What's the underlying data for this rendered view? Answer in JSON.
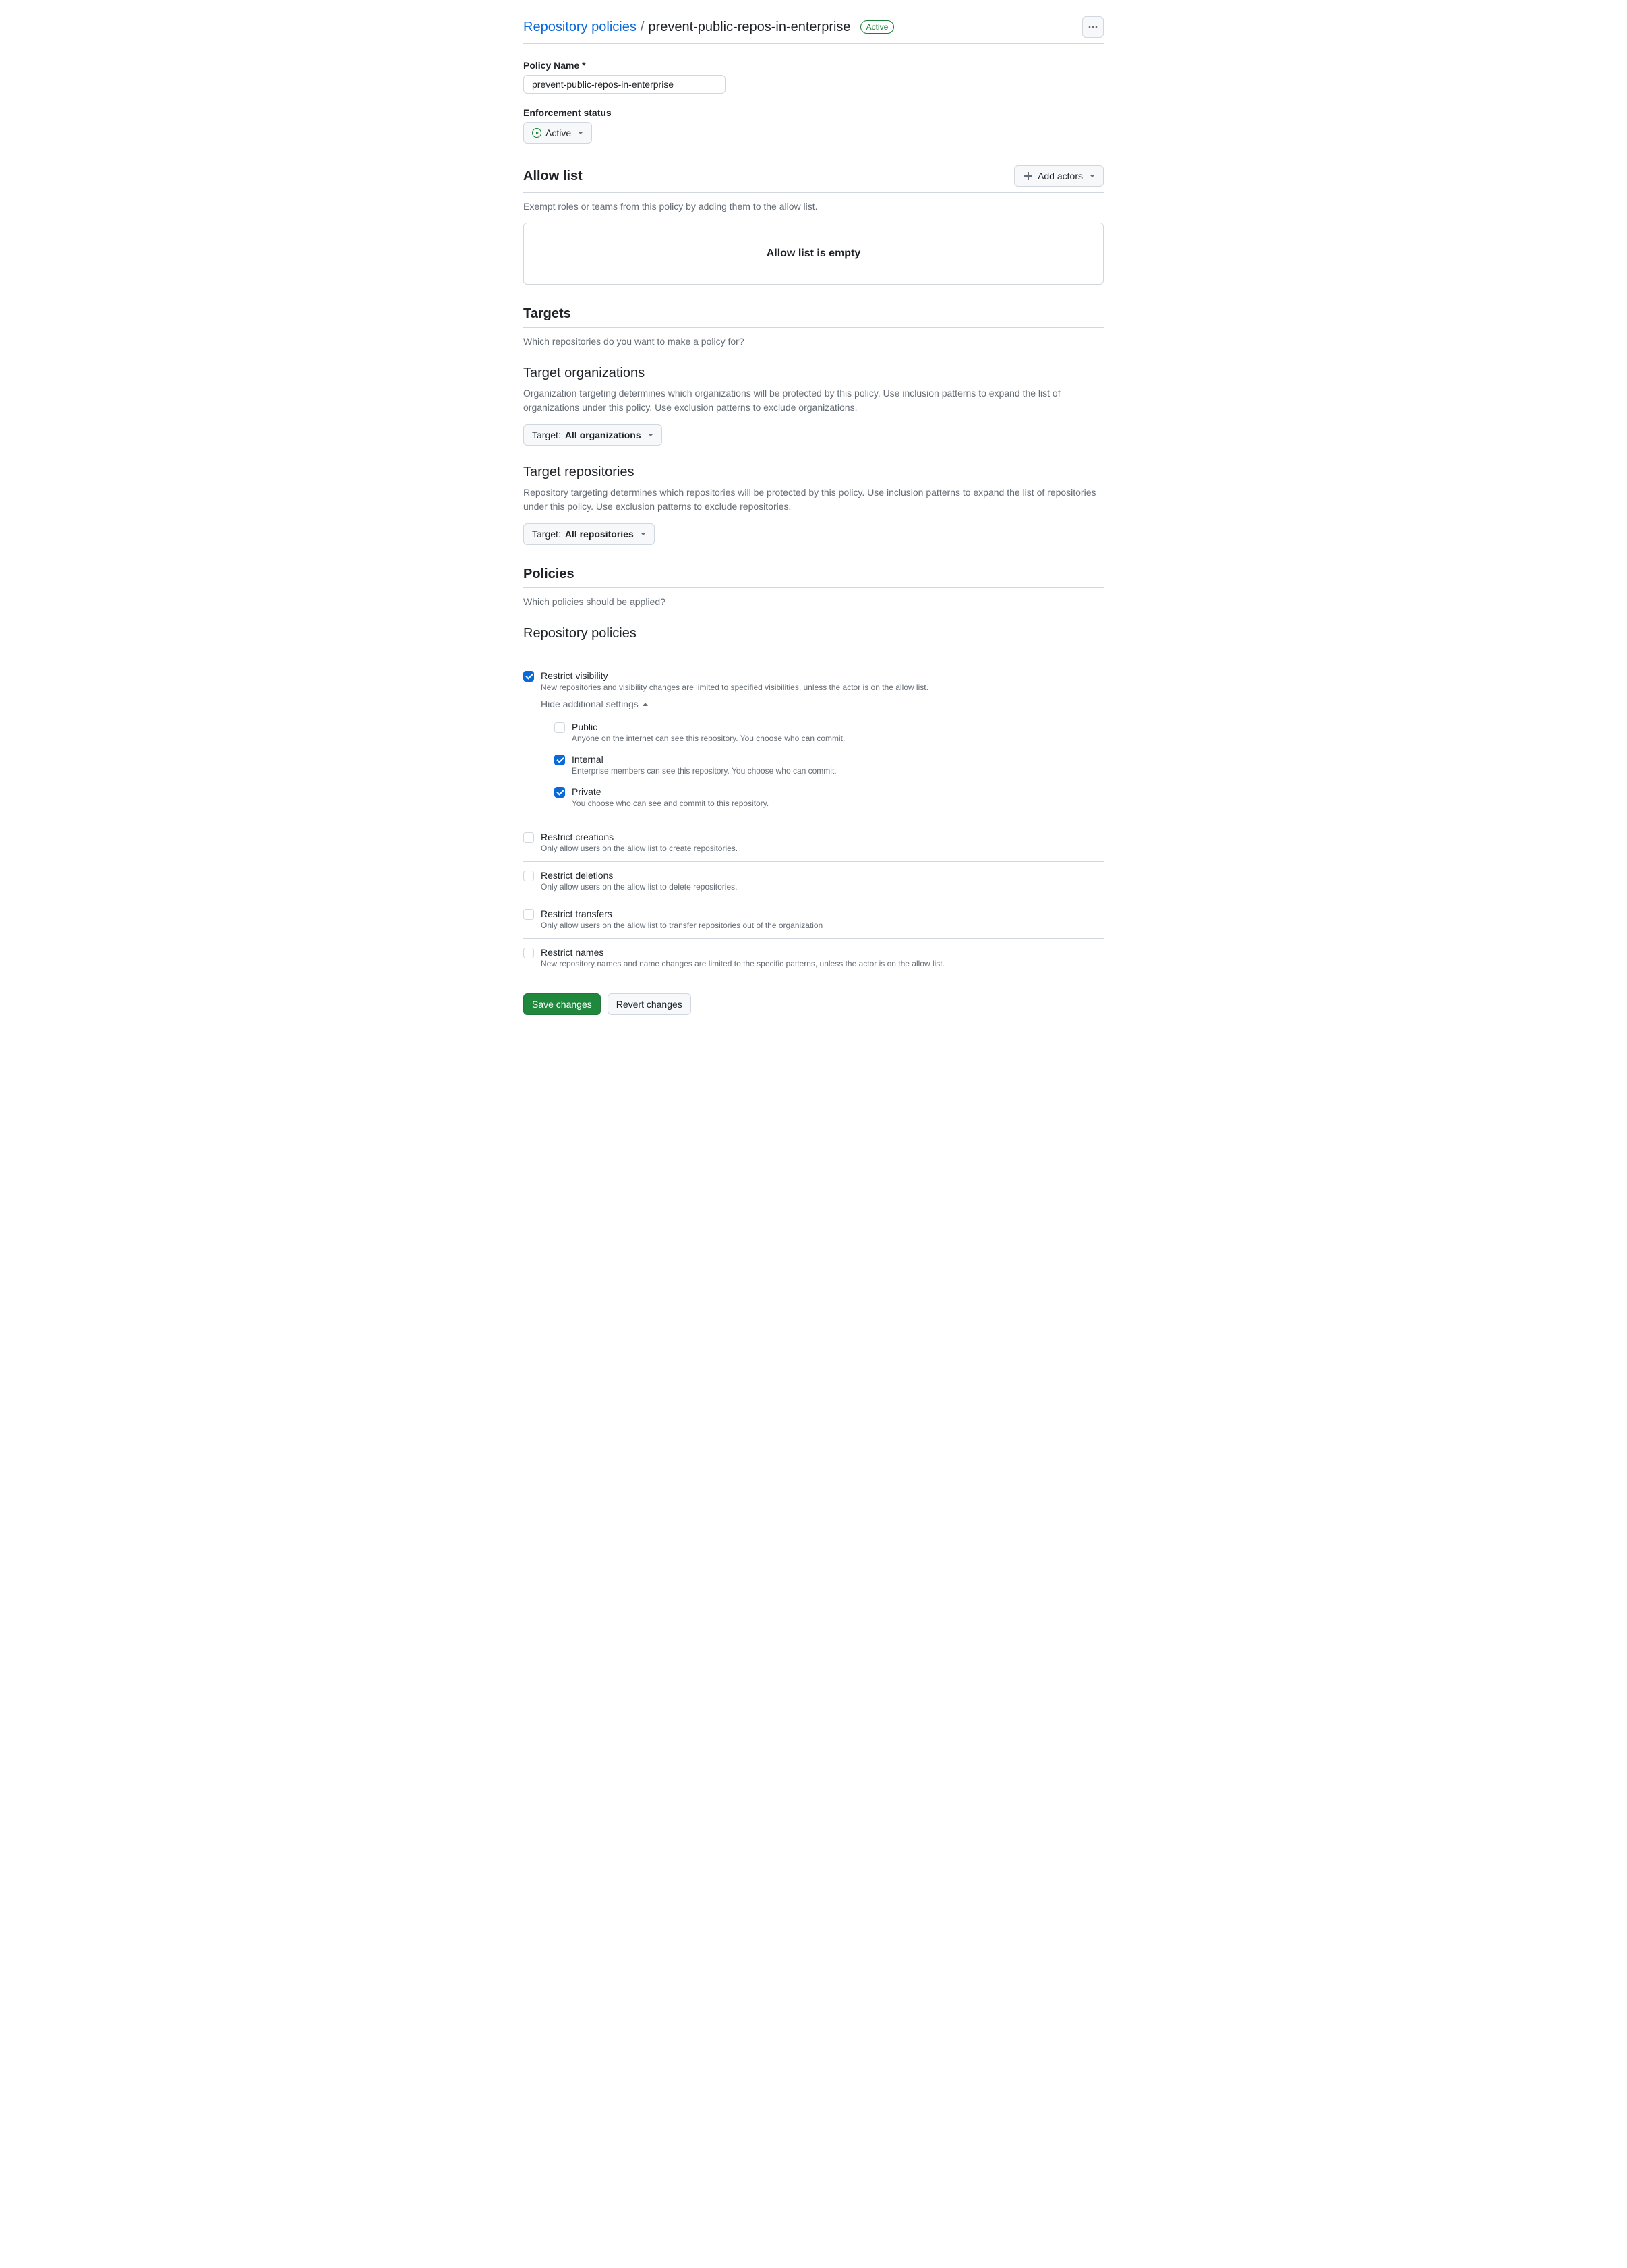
{
  "breadcrumb": {
    "parent": "Repository policies",
    "current": "prevent-public-repos-in-enterprise"
  },
  "status_badge": "Active",
  "policy_name": {
    "label": "Policy Name *",
    "value": "prevent-public-repos-in-enterprise"
  },
  "enforcement": {
    "label": "Enforcement status",
    "value": "Active"
  },
  "allow_list": {
    "title": "Allow list",
    "add_button": "Add actors",
    "description": "Exempt roles or teams from this policy by adding them to the allow list.",
    "empty_msg": "Allow list is empty"
  },
  "targets": {
    "title": "Targets",
    "description": "Which repositories do you want to make a policy for?",
    "orgs": {
      "title": "Target organizations",
      "description": "Organization targeting determines which organizations will be protected by this policy. Use inclusion patterns to expand the list of organizations under this policy. Use exclusion patterns to exclude organizations.",
      "button_prefix": "Target: ",
      "button_value": "All organizations"
    },
    "repos": {
      "title": "Target repositories",
      "description": "Repository targeting determines which repositories will be protected by this policy. Use inclusion patterns to expand the list of repositories under this policy. Use exclusion patterns to exclude repositories.",
      "button_prefix": "Target: ",
      "button_value": "All repositories"
    }
  },
  "policies": {
    "title": "Policies",
    "description": "Which policies should be applied?",
    "rp_title": "Repository policies",
    "toggle_label": "Hide additional settings",
    "rules": {
      "visibility": {
        "title": "Restrict visibility",
        "desc": "New repositories and visibility changes are limited to specified visibilities, unless the actor is on the allow list.",
        "checked": true
      },
      "creations": {
        "title": "Restrict creations",
        "desc": "Only allow users on the allow list to create repositories.",
        "checked": false
      },
      "deletions": {
        "title": "Restrict deletions",
        "desc": "Only allow users on the allow list to delete repositories.",
        "checked": false
      },
      "transfers": {
        "title": "Restrict transfers",
        "desc": "Only allow users on the allow list to transfer repositories out of the organization",
        "checked": false
      },
      "names": {
        "title": "Restrict names",
        "desc": "New repository names and name changes are limited to the specific patterns, unless the actor is on the allow list.",
        "checked": false
      }
    },
    "visibility_opts": {
      "public": {
        "title": "Public",
        "desc": "Anyone on the internet can see this repository. You choose who can commit.",
        "checked": false
      },
      "internal": {
        "title": "Internal",
        "desc": "Enterprise members can see this repository. You choose who can commit.",
        "checked": true
      },
      "private": {
        "title": "Private",
        "desc": "You choose who can see and commit to this repository.",
        "checked": true
      }
    }
  },
  "actions": {
    "save": "Save changes",
    "revert": "Revert changes"
  }
}
